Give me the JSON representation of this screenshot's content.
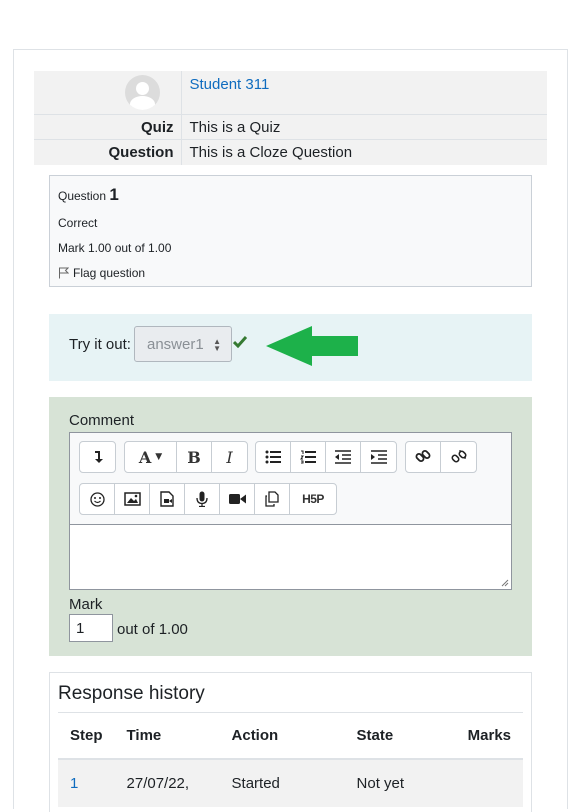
{
  "student": {
    "name": "Student 311"
  },
  "info": [
    {
      "label": "Quiz",
      "value": "This is a Quiz"
    },
    {
      "label": "Question",
      "value": "This is a Cloze Question"
    }
  ],
  "question_info": {
    "prefix": "Question",
    "number": "1",
    "state": "Correct",
    "mark": "Mark 1.00 out of 1.00",
    "flag_label": "Flag question"
  },
  "formulation": {
    "prompt": "Try it out:",
    "selected": "answer1",
    "arrow_color": "#1db14a",
    "tick_color": "#357a32"
  },
  "comment": {
    "label": "Comment",
    "mark_label": "Mark",
    "mark_value": "1",
    "out_of": "out of 1.00"
  },
  "toolbar": {
    "row1": [
      [
        "collapse-icon"
      ],
      [
        "font-color-icon",
        "bold-icon",
        "italic-icon"
      ],
      [
        "unordered-list-icon",
        "ordered-list-icon",
        "outdent-icon",
        "indent-icon"
      ],
      [
        "link-icon",
        "unlink-icon"
      ]
    ],
    "row2": [
      "emoji-icon",
      "image-icon",
      "media-icon",
      "record-audio-icon",
      "record-video-icon",
      "manage-files-icon",
      "h5p-icon"
    ]
  },
  "history": {
    "title": "Response history",
    "columns": [
      "Step",
      "Time",
      "Action",
      "State",
      "Marks"
    ],
    "rows": [
      {
        "step": "1",
        "time": "27/07/22,",
        "action": "Started",
        "state": "Not yet",
        "marks": ""
      }
    ]
  }
}
